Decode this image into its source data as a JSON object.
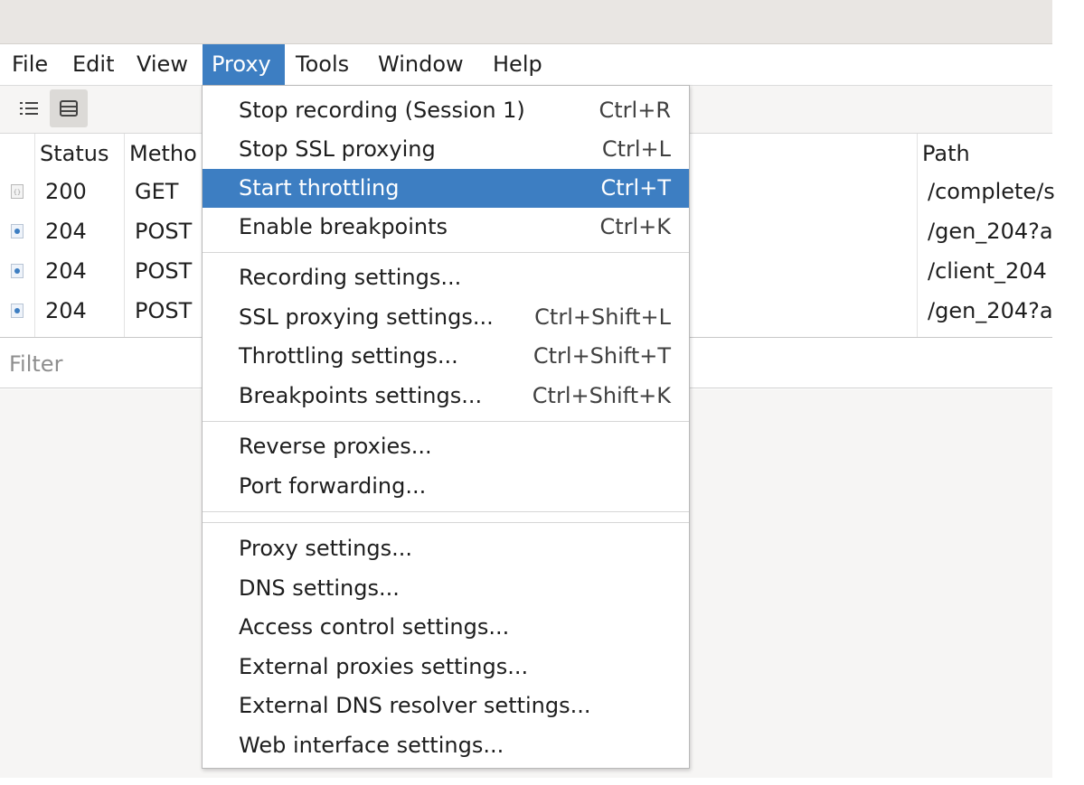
{
  "menubar": {
    "items": [
      {
        "label": "File"
      },
      {
        "label": "Edit"
      },
      {
        "label": "View"
      },
      {
        "label": "Proxy"
      },
      {
        "label": "Tools"
      },
      {
        "label": "Window"
      },
      {
        "label": "Help"
      }
    ],
    "active": "Proxy"
  },
  "toolbar": {
    "icons": [
      "list-view-icon",
      "detail-view-icon"
    ],
    "pressed": "detail-view-icon"
  },
  "table": {
    "columns": [
      "Status",
      "Metho",
      "Path"
    ],
    "rows": [
      {
        "icon": "json-file-icon",
        "status": "200",
        "method": "GET",
        "path": "/complete/s"
      },
      {
        "icon": "blue-dot-file-icon",
        "status": "204",
        "method": "POST",
        "path": "/gen_204?a"
      },
      {
        "icon": "blue-dot-file-icon",
        "status": "204",
        "method": "POST",
        "path": "/client_204"
      },
      {
        "icon": "blue-dot-file-icon",
        "status": "204",
        "method": "POST",
        "path": "/gen_204?a"
      }
    ]
  },
  "filter": {
    "placeholder": "Filter",
    "value": ""
  },
  "proxy_menu": {
    "items": [
      {
        "label": "Stop recording (Session 1)",
        "shortcut": "Ctrl+R"
      },
      {
        "label": "Stop SSL proxying",
        "shortcut": "Ctrl+L"
      },
      {
        "label": "Start throttling",
        "shortcut": "Ctrl+T"
      },
      {
        "label": "Enable breakpoints",
        "shortcut": "Ctrl+K"
      },
      {
        "label": "Recording settings...",
        "shortcut": ""
      },
      {
        "label": "SSL proxying settings...",
        "shortcut": "Ctrl+Shift+L"
      },
      {
        "label": "Throttling settings...",
        "shortcut": "Ctrl+Shift+T"
      },
      {
        "label": "Breakpoints settings...",
        "shortcut": "Ctrl+Shift+K"
      },
      {
        "label": "Reverse proxies...",
        "shortcut": ""
      },
      {
        "label": "Port forwarding...",
        "shortcut": ""
      },
      {
        "label": "Proxy settings...",
        "shortcut": ""
      },
      {
        "label": "DNS settings...",
        "shortcut": ""
      },
      {
        "label": "Access control settings...",
        "shortcut": ""
      },
      {
        "label": "External proxies settings...",
        "shortcut": ""
      },
      {
        "label": "External DNS resolver settings...",
        "shortcut": ""
      },
      {
        "label": "Web interface settings...",
        "shortcut": ""
      }
    ],
    "highlighted": "Start throttling"
  },
  "colors": {
    "accent": "#3d7ec2",
    "titlebar": "#e9e6e3",
    "panel": "#f6f5f4"
  }
}
